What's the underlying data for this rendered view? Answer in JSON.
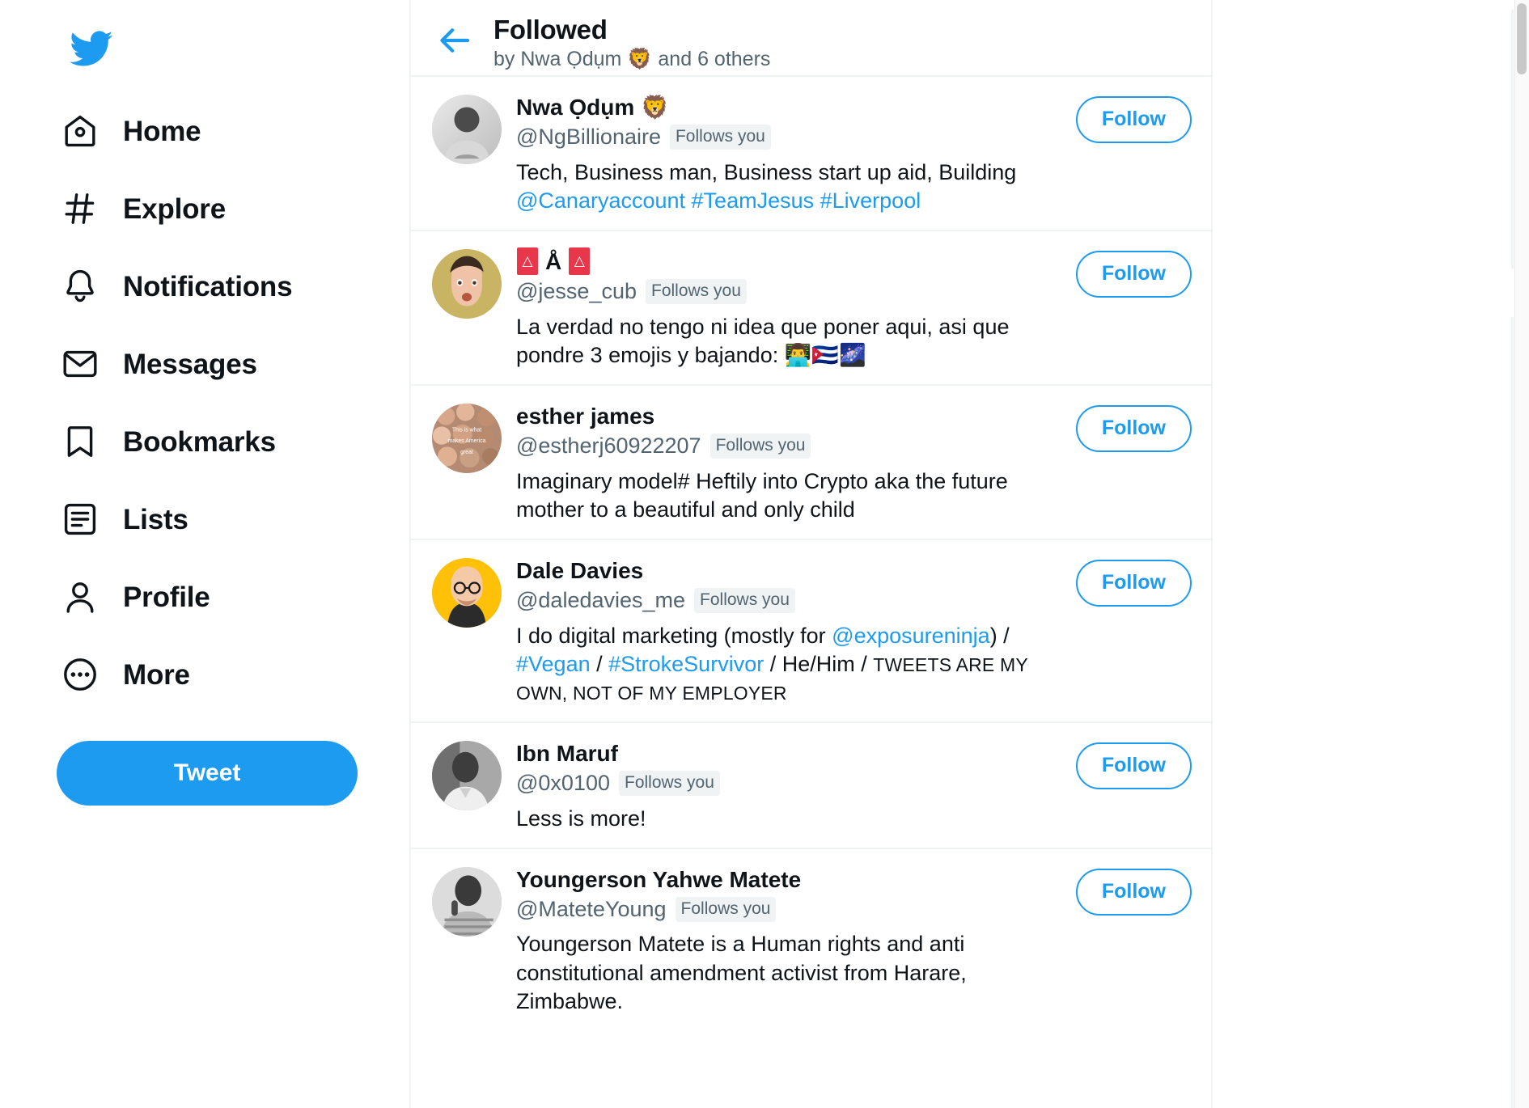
{
  "sidebar": {
    "logo_icon": "twitter-bird-icon",
    "items": [
      {
        "label": "Home",
        "icon": "home-icon"
      },
      {
        "label": "Explore",
        "icon": "hashtag-icon"
      },
      {
        "label": "Notifications",
        "icon": "bell-icon"
      },
      {
        "label": "Messages",
        "icon": "envelope-icon"
      },
      {
        "label": "Bookmarks",
        "icon": "bookmark-icon"
      },
      {
        "label": "Lists",
        "icon": "list-icon"
      },
      {
        "label": "Profile",
        "icon": "person-icon"
      },
      {
        "label": "More",
        "icon": "more-ellipsis-icon"
      }
    ],
    "tweet_button": "Tweet"
  },
  "header": {
    "back_icon": "back-arrow-icon",
    "title": "Followed",
    "subtitle": "by Nwa Ọdụm 🦁 and 6 others"
  },
  "follow_label": "Follow",
  "follows_you_label": "Follows you",
  "users": [
    {
      "name": "Nwa Ọdụm",
      "name_emoji": "🦁",
      "handle": "@NgBillionaire",
      "follows_you": "Follows you",
      "bio_parts": [
        {
          "text": "Tech, Business man, Business start up aid, Building ",
          "type": "plain"
        },
        {
          "text": "@Canaryaccount",
          "type": "link"
        },
        {
          "text": " ",
          "type": "plain"
        },
        {
          "text": "#TeamJesus",
          "type": "link"
        },
        {
          "text": " ",
          "type": "plain"
        },
        {
          "text": "#Liverpool",
          "type": "link"
        }
      ],
      "follow_label": "Follow"
    },
    {
      "name": "",
      "name_emoji": "",
      "name_tofu": true,
      "handle": "@jesse_cub",
      "follows_you": "Follows you",
      "bio_parts": [
        {
          "text": "La verdad no tengo ni idea que poner aqui, asi que pondre 3 emojis y bajando: ",
          "type": "plain"
        },
        {
          "text": "👨‍💻🇨🇺🌌",
          "type": "emoji"
        }
      ],
      "follow_label": "Follow"
    },
    {
      "name": "esther james",
      "name_emoji": "",
      "handle": "@estherj60922207",
      "follows_you": "Follows you",
      "bio_parts": [
        {
          "text": "Imaginary model# Heftily into Crypto aka the future mother to a beautiful and only child",
          "type": "plain"
        }
      ],
      "follow_label": "Follow"
    },
    {
      "name": "Dale Davies",
      "name_emoji": "",
      "handle": "@daledavies_me",
      "follows_you": "Follows you",
      "bio_parts": [
        {
          "text": "I do digital marketing (mostly for ",
          "type": "plain"
        },
        {
          "text": "@exposureninja",
          "type": "link"
        },
        {
          "text": ") / ",
          "type": "plain"
        },
        {
          "text": "#Vegan",
          "type": "link"
        },
        {
          "text": " / ",
          "type": "plain"
        },
        {
          "text": "#StrokeSurvivor",
          "type": "link"
        },
        {
          "text": " / He/Him / ",
          "type": "plain"
        },
        {
          "text": "TWEETS ARE MY OWN, NOT OF MY EMPLOYER",
          "type": "smallcaps"
        }
      ],
      "follow_label": "Follow"
    },
    {
      "name": "Ibn Maruf",
      "name_emoji": "",
      "handle": "@0x0100",
      "follows_you": "Follows you",
      "bio_parts": [
        {
          "text": "Less is more!",
          "type": "plain"
        }
      ],
      "follow_label": "Follow"
    },
    {
      "name": "Youngerson Yahwe Matete",
      "name_emoji": "",
      "handle": "@MateteYoung",
      "follows_you": "Follows you",
      "bio_parts": [
        {
          "text": "Youngerson Matete is a Human rights and anti constitutional amendment activist from Harare, Zimbabwe.",
          "type": "plain"
        }
      ],
      "follow_label": "Follow"
    }
  ],
  "colors": {
    "accent": "#1d9bf0",
    "text": "#0f1419",
    "muted": "#536471",
    "divider": "#eff3f4"
  }
}
